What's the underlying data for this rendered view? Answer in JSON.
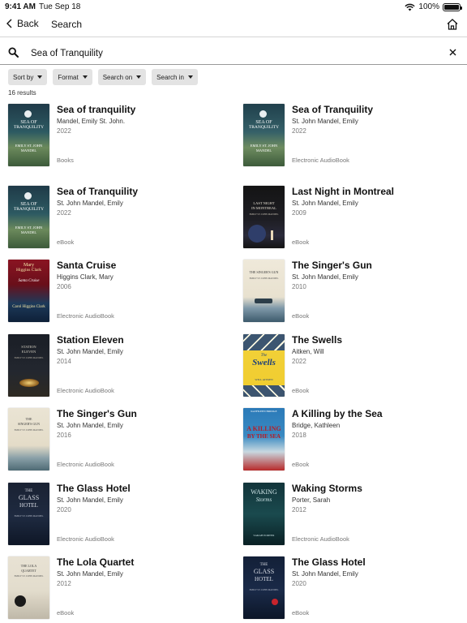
{
  "status": {
    "time": "9:41 AM",
    "date": "Tue Sep 18",
    "battery": "100%"
  },
  "nav": {
    "back_label": "Back",
    "title": "Search"
  },
  "search": {
    "value": "Sea of Tranquility"
  },
  "filters": [
    "Sort by",
    "Format",
    "Search on",
    "Search in"
  ],
  "results_count": "16 results",
  "results": [
    {
      "title": "Sea of tranquility",
      "author": "Mandel, Emily St. John.",
      "year": "2022",
      "format": "Books",
      "cover_lines": [
        "SEA OF",
        "TRANQUILITY",
        "EMILY ST. JOHN",
        "MANDEL"
      ]
    },
    {
      "title": "Sea of Tranquility",
      "author": "St. John Mandel, Emily",
      "year": "2022",
      "format": "Electronic AudioBook",
      "cover_lines": [
        "SEA OF",
        "TRANQUILITY",
        "EMILY ST. JOHN",
        "MANDEL"
      ]
    },
    {
      "title": "Sea of Tranquility",
      "author": "St. John Mandel, Emily",
      "year": "2022",
      "format": "eBook",
      "cover_lines": [
        "SEA OF",
        "TRANQUILITY",
        "EMILY ST. JOHN",
        "MANDEL"
      ]
    },
    {
      "title": "Last Night in Montreal",
      "author": "St. John Mandel, Emily",
      "year": "2009",
      "format": "eBook",
      "cover_lines": [
        "LAST NIGHT",
        "IN MONTREAL",
        "EMILY ST. JOHN MANDEL",
        ""
      ]
    },
    {
      "title": "Santa Cruise",
      "author": "Higgins Clark, Mary",
      "year": "2006",
      "format": "Electronic AudioBook",
      "cover_lines": [
        "Mary",
        "Higgins Clark",
        "Santa Cruise",
        "Carol Higgins Clark"
      ]
    },
    {
      "title": "The Singer's Gun",
      "author": "St. John Mandel, Emily",
      "year": "2010",
      "format": "eBook",
      "cover_lines": [
        "THE SINGER'S GUN",
        "",
        "EMILY ST. JOHN MANDEL",
        ""
      ]
    },
    {
      "title": "Station Eleven",
      "author": "St. John Mandel, Emily",
      "year": "2014",
      "format": "Electronic AudioBook",
      "cover_lines": [
        "STATION",
        "ELEVEN",
        "EMILY ST. JOHN MANDEL",
        ""
      ]
    },
    {
      "title": "The Swells",
      "author": "Aitken, Will",
      "year": "2022",
      "format": "eBook",
      "cover_lines": [
        "The",
        "Swells",
        "WILL AITKEN",
        ""
      ]
    },
    {
      "title": "The Singer's Gun",
      "author": "St. John Mandel, Emily",
      "year": "2016",
      "format": "Electronic AudioBook",
      "cover_lines": [
        "THE",
        "SINGER'S GUN",
        "EMILY ST. JOHN MANDEL",
        ""
      ]
    },
    {
      "title": "A Killing by the Sea",
      "author": "Bridge, Kathleen",
      "year": "2018",
      "format": "eBook",
      "cover_lines": [
        "KATHLEEN BRIDGE",
        "A KILLING",
        "BY THE SEA",
        ""
      ]
    },
    {
      "title": "The Glass Hotel",
      "author": "St. John Mandel, Emily",
      "year": "2020",
      "format": "Electronic AudioBook",
      "cover_lines": [
        "THE",
        "GLASS",
        "HOTEL",
        "EMILY ST. JOHN MANDEL"
      ]
    },
    {
      "title": "Waking Storms",
      "author": "Porter, Sarah",
      "year": "2012",
      "format": "Electronic AudioBook",
      "cover_lines": [
        "WAKING",
        "Storms",
        "SARAH PORTER",
        ""
      ]
    },
    {
      "title": "The Lola Quartet",
      "author": "St. John Mandel, Emily",
      "year": "2012",
      "format": "eBook",
      "cover_lines": [
        "THE LOLA",
        "QUARTET",
        "EMILY ST. JOHN MANDEL",
        ""
      ]
    },
    {
      "title": "The Glass Hotel",
      "author": "St. John Mandel, Emily",
      "year": "2020",
      "format": "eBook",
      "cover_lines": [
        "THE",
        "GLASS",
        "HOTEL",
        "EMILY ST. JOHN MANDEL"
      ]
    }
  ],
  "colors": {
    "accent": "#111111",
    "filter_bg": "#e3e3e3",
    "meta_gray": "#777777"
  },
  "icons": {
    "back": "chevron-left-icon",
    "home": "home-icon",
    "search": "search-icon",
    "clear": "close-icon",
    "wifi": "wifi-icon",
    "battery": "battery-icon"
  }
}
